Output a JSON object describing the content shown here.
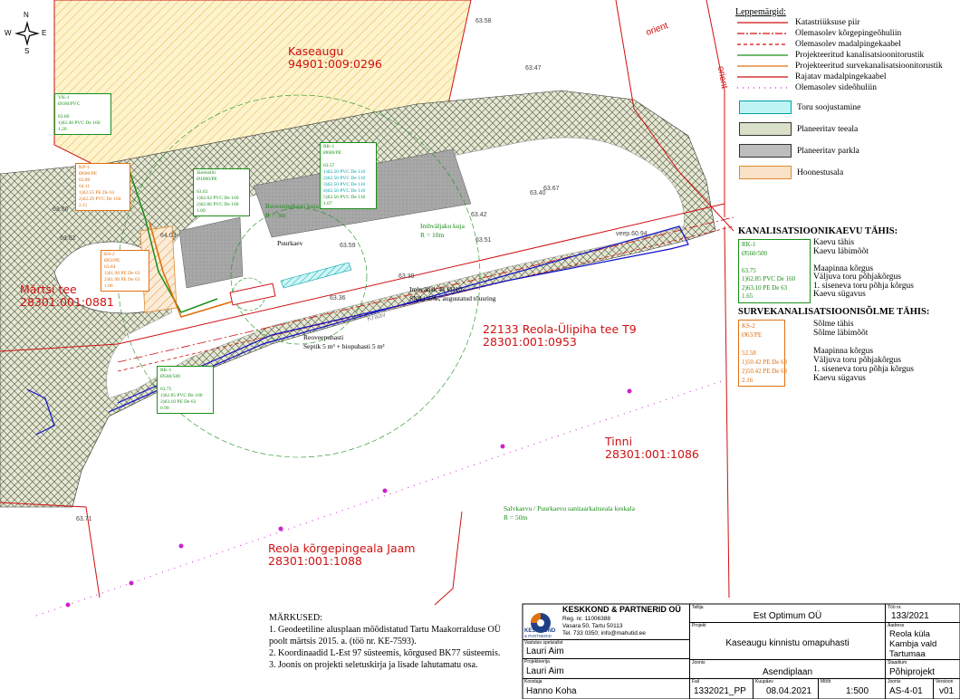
{
  "map": {
    "parcels": {
      "kaseaugu": {
        "name": "Kaseaugu",
        "code": "94901:009:0296"
      },
      "martsi": {
        "name": "Märtsi tee",
        "code": "28301:001:0881"
      },
      "reola": {
        "name": "22133 Reola-Ülipiha tee T9",
        "code": "28301:001:0953"
      },
      "tinni": {
        "name": "Tinni",
        "code": "28301:001:1086"
      },
      "alajaam": {
        "name": "Reola kõrgepingeala Jaam",
        "code": "28301:001:1088"
      }
    },
    "ris_fragment": "orient",
    "road_text": "Kraav",
    "compass": {
      "n": "N",
      "e": "E",
      "w": "W",
      "s": "S"
    },
    "callouts": {
      "vk1": [
        "VK-1",
        "Ø160/PVC",
        "",
        "63.60",
        "1)62.40 PVC De 160",
        "1.20"
      ],
      "kp1": [
        "KP-1",
        "Ø600/PE",
        "63.80",
        "64.11",
        "1)62.55 PE De 63",
        "2)62.29 PVC De 160",
        "2.11"
      ],
      "ks2": [
        "KS-2",
        "Ø63/PE",
        "63.84",
        "1)61.98 PE De 63",
        "2)61.98 PE De 63",
        "1.86"
      ],
      "jarel": [
        "Järelsetiti",
        "Ø1000/PE",
        "",
        "63.62",
        "1)62.62 PVC De 160",
        "2)62.66 PVC De 160",
        "1.00"
      ],
      "rk1top": [
        "RK-1",
        "Ø600/PE",
        "",
        "63.57",
        "1)62.50 PVC De 110",
        "2)62.50 PVC De 110",
        "3)62.50 PVC De 110",
        "4)62.50 PVC De 110",
        "5)62.50 PVC De 110",
        "1.07"
      ],
      "rk1bot": [
        "RK-1",
        "Ø560/500",
        "",
        "63.75",
        "1)62.85 PVC De 160",
        "2)63.10 PE De 63",
        "0.90"
      ]
    },
    "labels": {
      "reovee_kuja": "Reoveepuhasti kuja",
      "r5": "R = 5m",
      "imbvaljak_kuja": "Imbväljaku kuja",
      "r10": "R = 10m",
      "puurkaev": "Puurkaev",
      "imbvaljak": "Imbväljak 4x Ø110",
      "imbvaljak_sub": "SN8 i=5‰, augustatud tõusring",
      "reoveepuhasti": "Reoveepuhasti",
      "septik": "Septik 5 m³ + biopuhasti 5 m³",
      "salvkaevu": "Salvkaevu / Puurkaevu sanitaarkaitseala keskala",
      "r50": "R = 50m",
      "elev_a": "63.51",
      "elev_b": "63.59",
      "elev_c": "63.80",
      "elev_d": "63.82",
      "elev_e": "63.67",
      "elev_f": "63.42",
      "elev_g": "63.40",
      "elev_h": "63.71",
      "elev_i": "63.36",
      "elev_j": "64.03",
      "elev_k": "63.39",
      "elev_l": "63.47",
      "elev_m": "63.58",
      "vee": "veeр.60.94"
    }
  },
  "legend": {
    "title": "Leppemärgid:",
    "lines": [
      {
        "label": "Katastriüksuse piir",
        "color": "#d01010",
        "style": "solid"
      },
      {
        "label": "Olemasolev kõrgepingeõhuliin",
        "color": "#d01010",
        "style": "dashdot"
      },
      {
        "label": "Olemasolev madalpingekaabel",
        "color": "#d01010",
        "style": "dash"
      },
      {
        "label": "Projekteeritud kanalisatsioonitorustik",
        "color": "#1a8f1a",
        "style": "solid"
      },
      {
        "label": "Projekteeritud survekanalisatsioonitorustik",
        "color": "#e07010",
        "style": "solid"
      },
      {
        "label": "Rajatav madalpingekaabel",
        "color": "#d01010",
        "style": "solid"
      },
      {
        "label": "Olemasolev sideõhuliin",
        "color": "#cc22cc",
        "style": "dots"
      }
    ],
    "areas": [
      {
        "label": "Toru soojustamine",
        "fill": "#bff4f4",
        "border": "#00a0a8"
      },
      {
        "label": "Planeeritav teeala",
        "fill": "#d9e0c8",
        "border": "#333"
      },
      {
        "label": "Planeeritav parkla",
        "fill": "#bdbdbd",
        "border": "#333"
      },
      {
        "label": "Hoonestusala",
        "fill": "#f8e2c8",
        "border": "#e08a30"
      }
    ]
  },
  "kanal": {
    "title": "KANALISATSIOONIKAEVU TÄHIS:",
    "box": [
      "RK-1",
      "Ø560/500",
      "",
      "63.75",
      "1)62.85 PVC De 160",
      "2)63.10 PE De 63",
      "1.65"
    ],
    "desc": [
      "Kaevu tähis",
      "Kaevu läbimõõt",
      "",
      "Maapinna kõrgus",
      "Väljuva toru põhjakõrgus",
      "1. siseneva toru põhja kõrgus",
      "Kaevu sügavus"
    ]
  },
  "surve": {
    "title": "SURVEKANALISATSIOONISÕLME TÄHIS:",
    "box": [
      "KS-2",
      "Ø63/PE",
      "",
      "52.58",
      "1)50.42 PE De 63",
      "2)50.42 PE De 63",
      "2.16"
    ],
    "desc": [
      "Sõlme tähis",
      "Sõlme läbimõõt",
      "",
      "Maapinna kõrgus",
      "Väljuva toru põhjakõrgus",
      "1. siseneva toru põhja kõrgus",
      "Kaevu sügavus"
    ]
  },
  "notes": {
    "title": "MÄRKUSED:",
    "items": [
      "1. Geodeetiline alusplaan mõõdistatud Tartu Maakorralduse OÜ",
      "poolt märtsis 2015. a. (töö nr. KE-7593).",
      "2. Koordinaadid L-Est 97 süsteemis, kõrgused BK77 süsteemis.",
      "3. Joonis on projekti seletuskirja ja lisade lahutamatu osa."
    ]
  },
  "titleblock": {
    "company": "KESKKOND & PARTNERID OÜ",
    "logo": "KESKKOND",
    "logo_sub": "& PARTNERID",
    "reg": "Reg. nr. 11006388",
    "address": "Vasara 50, Tartu 50113",
    "contact": "Tel. 733 0350; info@mahutid.ee",
    "tellija_cap": "Tellija",
    "tellija": "Est Optimum OÜ",
    "toonr_cap": "Töö nr.",
    "toonr": "133/2021",
    "projekt_cap": "Projekt",
    "projekt": "Kaseaugu kinnistu omapuhasti",
    "aadress_cap": "Aadress",
    "aadress": [
      "Reola küla",
      "Kambja vald",
      "Tartumaa"
    ],
    "vastutav_cap": "Vastutav spetsialist",
    "vastutav": "Lauri Aim",
    "projekteerija_cap": "Projekteerija",
    "projekteerija": "Lauri Aim",
    "joonis_cap": "Joonis",
    "joonis": "Asendiplaan",
    "staadium_cap": "Staadium",
    "staadium": "Põhiprojekt",
    "koostaja_cap": "Koostaja",
    "koostaja": "Hanno Koha",
    "fail_cap": "Fail",
    "fail": "1332021_PP",
    "kuupaev_cap": "Kuupäev",
    "kuupaev": "08.04.2021",
    "moot_cap": "Mõõt",
    "moot": "1:500",
    "joonisnr_cap": "Joonis",
    "joonisnr": "AS-4-01",
    "versioon_cap": "Versioon",
    "versioon": "v01"
  }
}
